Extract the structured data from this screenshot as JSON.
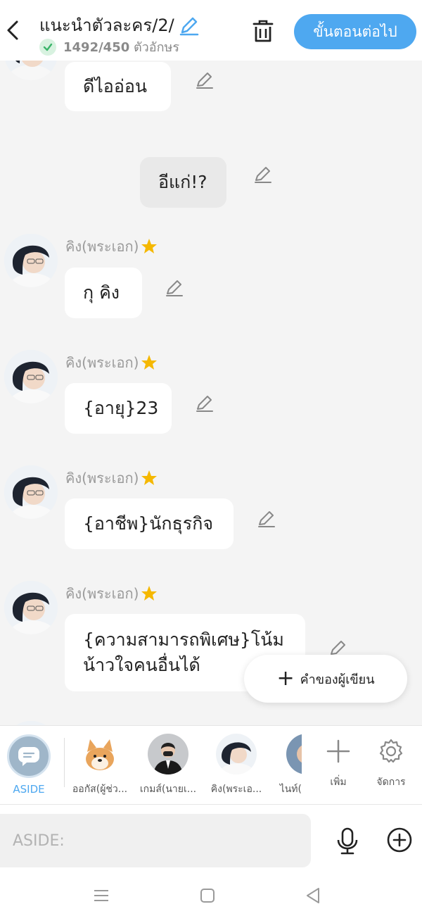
{
  "header": {
    "title": "แนะนำตัวละคร/2/",
    "char_count": "1492/450",
    "char_count_unit": "ตัวอักษร",
    "next_label": "ขั้นตอนต่อไป",
    "icons": [
      "back-arrow-icon",
      "pencil-icon",
      "check-icon",
      "trash-icon"
    ]
  },
  "messages": [
    {
      "text": "ดีไออ่อน"
    },
    {
      "text": "อีแก่!?"
    },
    {
      "sender": "คิง(พระเอก)",
      "text": "กุ คิง"
    },
    {
      "sender": "คิง(พระเอก)",
      "text": "{อายุ}23"
    },
    {
      "sender": "คิง(พระเอก)",
      "text": "{อาชีพ}นักธุรกิจ"
    },
    {
      "sender": "คิง(พระเอก)",
      "text_line1": "{ความสามารถพิเศษ}โน้ม",
      "text_line2": "น้าวใจคนอื่นได้"
    }
  ],
  "fab": {
    "label": "คำของผู้เขียน"
  },
  "charbar": {
    "aside_label": "ASIDE",
    "characters": [
      {
        "name": "ออกัส(ผู้ช่ว..."
      },
      {
        "name": "เกมส์(นายเ..."
      },
      {
        "name": "คิง(พระเอ..."
      },
      {
        "name": "ไนท์("
      }
    ],
    "add_label": "เพิ่ม",
    "manage_label": "จัดการ"
  },
  "input": {
    "placeholder": "ASIDE:"
  },
  "colors": {
    "accent": "#4ea8f0",
    "check_green": "#3bb56a",
    "star": "#f5b800"
  }
}
